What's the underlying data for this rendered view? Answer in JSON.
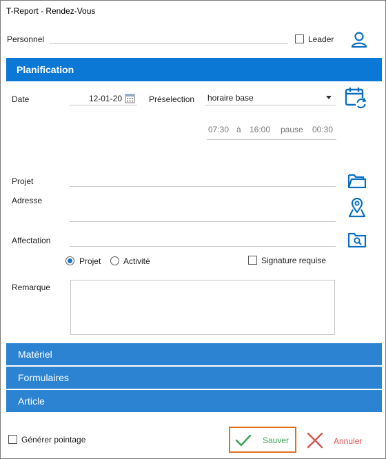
{
  "window": {
    "title": "T-Report - Rendez-Vous"
  },
  "personnel": {
    "label": "Personnel",
    "value": "",
    "leader_label": "Leader",
    "leader_checked": false,
    "icon": "user-icon"
  },
  "planification": {
    "header": "Planification",
    "date_label": "Date",
    "date_value": "12-01-20",
    "preselection_label": "Préselection",
    "preselection_value": "horaire base",
    "time_start": "07:30",
    "time_sep": "à",
    "time_end": "16:00",
    "pause_label": "pause",
    "pause_value": "00:30",
    "projet_label": "Projet",
    "projet_value": "",
    "adresse_label": "Adresse",
    "adresse_value": "",
    "affectation_label": "Affectation",
    "affectation_value": "",
    "radio_projet": "Projet",
    "radio_activite": "Activité",
    "radio_selected": "Projet",
    "signature_label": "Signature requise",
    "signature_checked": false,
    "remarque_label": "Remarque",
    "remarque_value": ""
  },
  "sections": {
    "materiel": "Matériel",
    "formulaires": "Formulaires",
    "article": "Article"
  },
  "footer": {
    "generer_label": "Générer pointage",
    "generer_checked": false,
    "save_label": "Sauver",
    "cancel_label": "Annuler"
  },
  "colors": {
    "header_blue": "#0c78d6",
    "section_blue": "#2b83d1",
    "icon_blue": "#0a6fc2",
    "save_green": "#3aa655",
    "cancel_red": "#d9534f",
    "save_border": "#e07020"
  }
}
